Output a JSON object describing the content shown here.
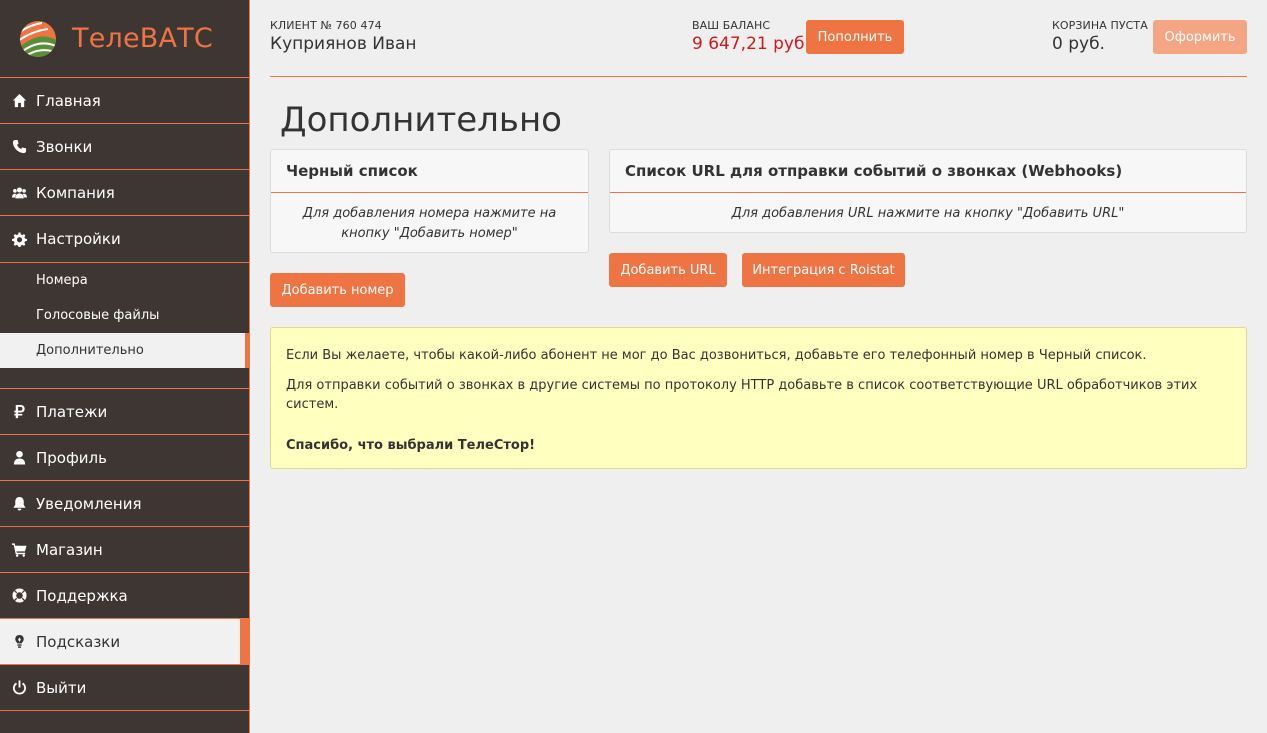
{
  "brand": {
    "name": "ТелеВАТС"
  },
  "sidebar": {
    "items_top": [
      {
        "label": "Главная",
        "icon": "home-icon"
      },
      {
        "label": "Звонки",
        "icon": "phone-icon"
      },
      {
        "label": "Компания",
        "icon": "users-icon"
      },
      {
        "label": "Настройки",
        "icon": "gear-icon"
      }
    ],
    "sub_items": [
      {
        "label": "Номера"
      },
      {
        "label": "Голосовые файлы"
      },
      {
        "label": "Дополнительно",
        "active": true
      }
    ],
    "items_bottom": [
      {
        "label": "Платежи",
        "icon": "ruble-icon"
      },
      {
        "label": "Профиль",
        "icon": "user-icon"
      },
      {
        "label": "Уведомления",
        "icon": "bell-icon"
      },
      {
        "label": "Магазин",
        "icon": "cart-icon"
      },
      {
        "label": "Поддержка",
        "icon": "lifebuoy-icon"
      },
      {
        "label": "Подсказки",
        "icon": "lightbulb-icon",
        "highlighted": true
      },
      {
        "label": "Выйти",
        "icon": "power-icon"
      }
    ]
  },
  "header": {
    "client_label": "КЛИЕНТ № 760 474",
    "client_name": "Куприянов Иван",
    "balance_label": "ВАШ БАЛАНС",
    "balance_value": "9 647,21 руб.",
    "topup_button": "Пополнить",
    "cart_label": "КОРЗИНА ПУСТА",
    "cart_value": "0 руб.",
    "checkout_button": "Оформить"
  },
  "main": {
    "title": "Дополнительно",
    "blacklist": {
      "title": "Черный список",
      "hint": "Для добавления номера нажмите на кнопку \"Добавить номер\"",
      "add_button": "Добавить номер"
    },
    "webhooks": {
      "title": "Список URL для отправки событий о звонках (Webhooks)",
      "hint": "Для добавления URL нажмите на кнопку \"Добавить URL\"",
      "add_button": "Добавить URL",
      "roistat_button": "Интеграция с Roistat"
    },
    "notice": {
      "line1": "Если Вы желаете, чтобы какой-либо абонент не мог до Вас дозвониться, добавьте его телефонный номер в Черный список.",
      "line2": "Для отправки событий о звонках в другие системы по протоколу HTTP добавьте в список соответствующие URL обработчиков этих систем.",
      "thanks": "Спасибо, что выбрали ТелеСтор!"
    }
  },
  "colors": {
    "accent": "#ee7443",
    "sidebar_bg": "#3e3633",
    "balance": "#cc1b1b",
    "notice_bg": "#ffffc0"
  }
}
